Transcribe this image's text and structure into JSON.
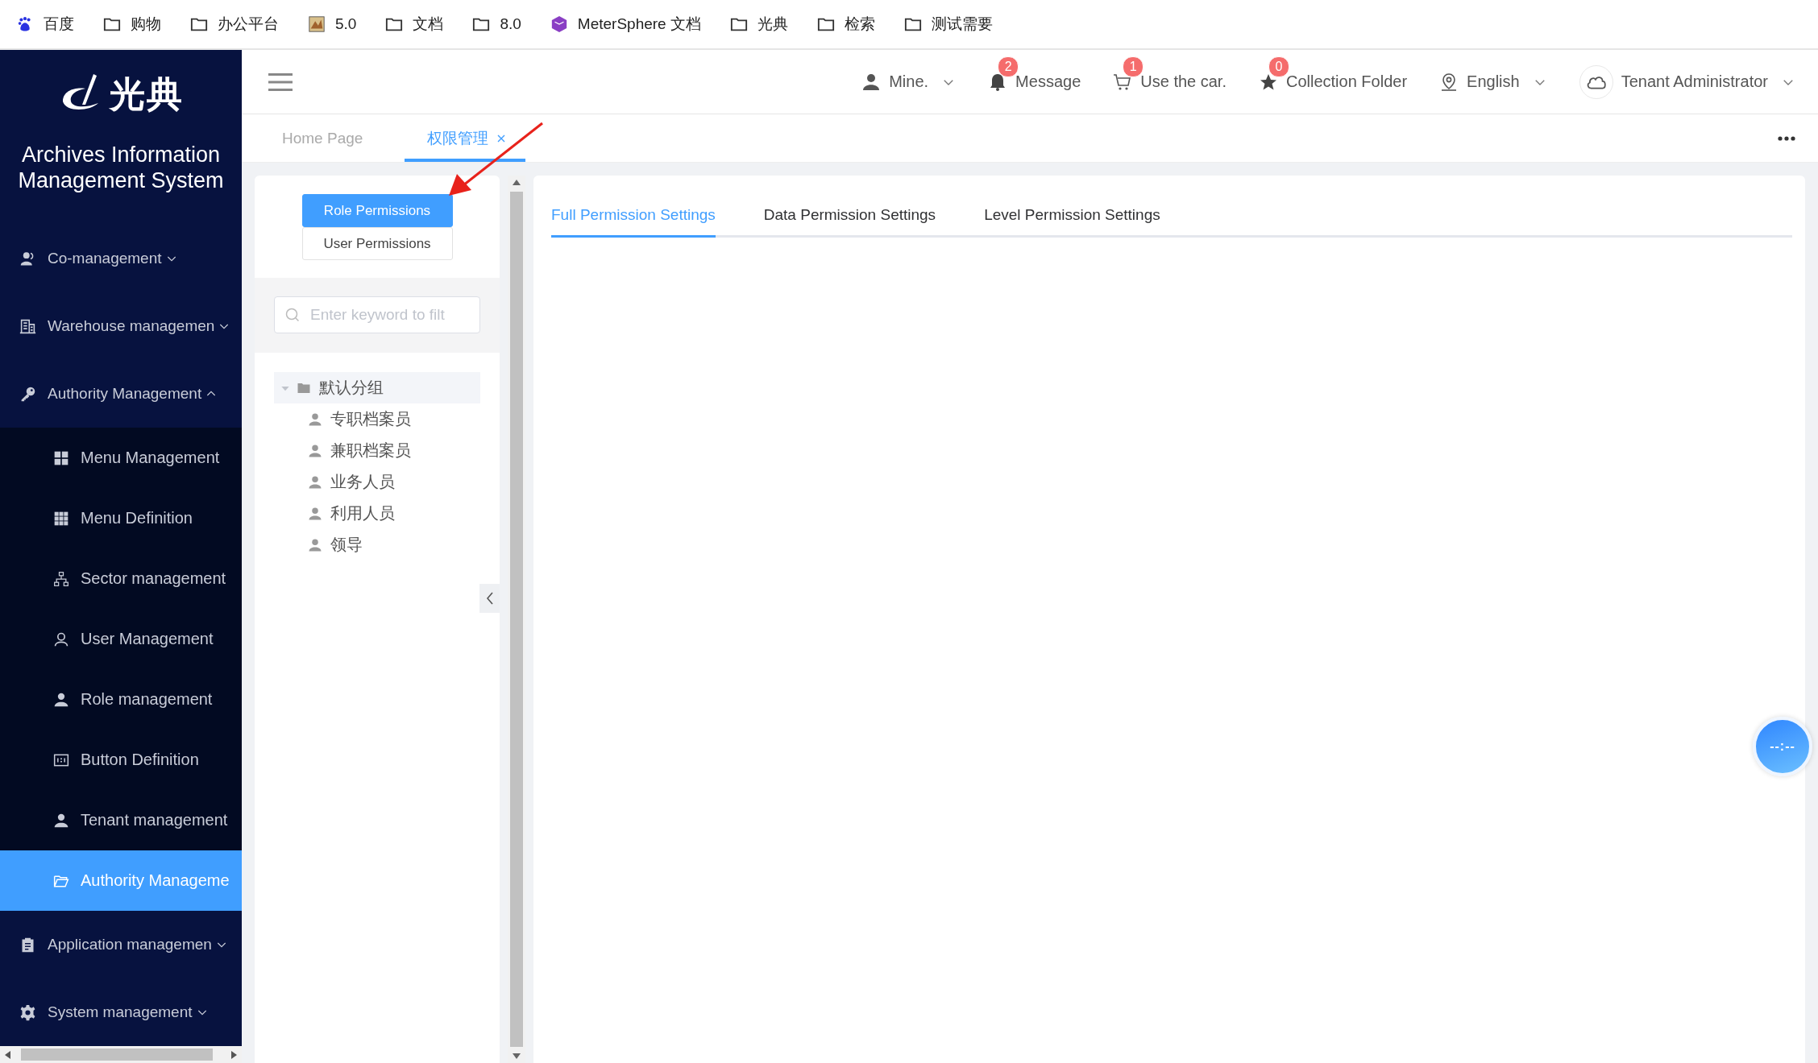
{
  "bookmarks": [
    {
      "kind": "baidu",
      "label": "百度"
    },
    {
      "kind": "folder",
      "label": "购物"
    },
    {
      "kind": "folder",
      "label": "办公平台"
    },
    {
      "kind": "image",
      "label": "5.0"
    },
    {
      "kind": "folder",
      "label": "文档"
    },
    {
      "kind": "folder",
      "label": "8.0"
    },
    {
      "kind": "cube",
      "label": "MeterSphere 文档"
    },
    {
      "kind": "folder",
      "label": "光典"
    },
    {
      "kind": "folder",
      "label": "检索"
    },
    {
      "kind": "folder",
      "label": "测试需要"
    }
  ],
  "sidebar": {
    "logo_text": "光典",
    "title": "Archives Information Management System",
    "items": [
      {
        "kind": "people",
        "label": "Co-management",
        "expanded": false
      },
      {
        "kind": "building",
        "label": "Warehouse managemen",
        "expanded": false
      },
      {
        "kind": "key",
        "label": "Authority Management",
        "expanded": true,
        "children": [
          {
            "kind": "grid4",
            "label": "Menu Management",
            "selected": false
          },
          {
            "kind": "grid9",
            "label": "Menu Definition",
            "selected": false
          },
          {
            "kind": "org",
            "label": "Sector management",
            "selected": false
          },
          {
            "kind": "user-outline",
            "label": "User Management",
            "selected": false
          },
          {
            "kind": "user-solid",
            "label": "Role management",
            "selected": false
          },
          {
            "kind": "button-def",
            "label": "Button Definition",
            "selected": false
          },
          {
            "kind": "user-solid",
            "label": "Tenant management",
            "selected": false
          },
          {
            "kind": "folder-open",
            "label": "Authority Manageme",
            "selected": true
          }
        ]
      },
      {
        "kind": "clipboard",
        "label": "Application managemen",
        "expanded": false
      },
      {
        "kind": "gear",
        "label": "System management",
        "expanded": false
      }
    ]
  },
  "header": {
    "items": [
      {
        "kind": "user",
        "label": "Mine.",
        "dropdown": true
      },
      {
        "kind": "bell",
        "label": "Message",
        "badge": "2"
      },
      {
        "kind": "cart",
        "label": "Use the car.",
        "badge": "1"
      },
      {
        "kind": "star",
        "label": "Collection Folder",
        "badge": "0"
      },
      {
        "kind": "pin",
        "label": "English",
        "dropdown": true
      },
      {
        "kind": "cloud",
        "label": "Tenant Administrator",
        "dropdown": true
      }
    ]
  },
  "tabs": [
    {
      "label": "Home Page",
      "selected": false,
      "closable": false
    },
    {
      "label": "权限管理",
      "selected": true,
      "closable": true
    }
  ],
  "permission_panel": {
    "mode_buttons": [
      {
        "label": "Role Permissions",
        "selected": true
      },
      {
        "label": "User Permissions",
        "selected": false
      }
    ],
    "search": {
      "placeholder": "Enter keyword to filt"
    },
    "tree": [
      {
        "kind": "folder",
        "label": "默认分组",
        "expanded": true,
        "selected": true,
        "children": [
          {
            "kind": "user",
            "label": "专职档案员",
            "selected": false
          },
          {
            "kind": "user",
            "label": "兼职档案员",
            "selected": false
          },
          {
            "kind": "user",
            "label": "业务人员",
            "selected": false
          },
          {
            "kind": "user",
            "label": "利用人员",
            "selected": false
          },
          {
            "kind": "user",
            "label": "领导",
            "selected": false
          }
        ]
      }
    ]
  },
  "settings_tabs": [
    {
      "label": "Full Permission Settings",
      "selected": true
    },
    {
      "label": "Data Permission Settings",
      "selected": false
    },
    {
      "label": "Level Permission Settings",
      "selected": false
    }
  ],
  "floating_clock": {
    "text": "--:--"
  }
}
